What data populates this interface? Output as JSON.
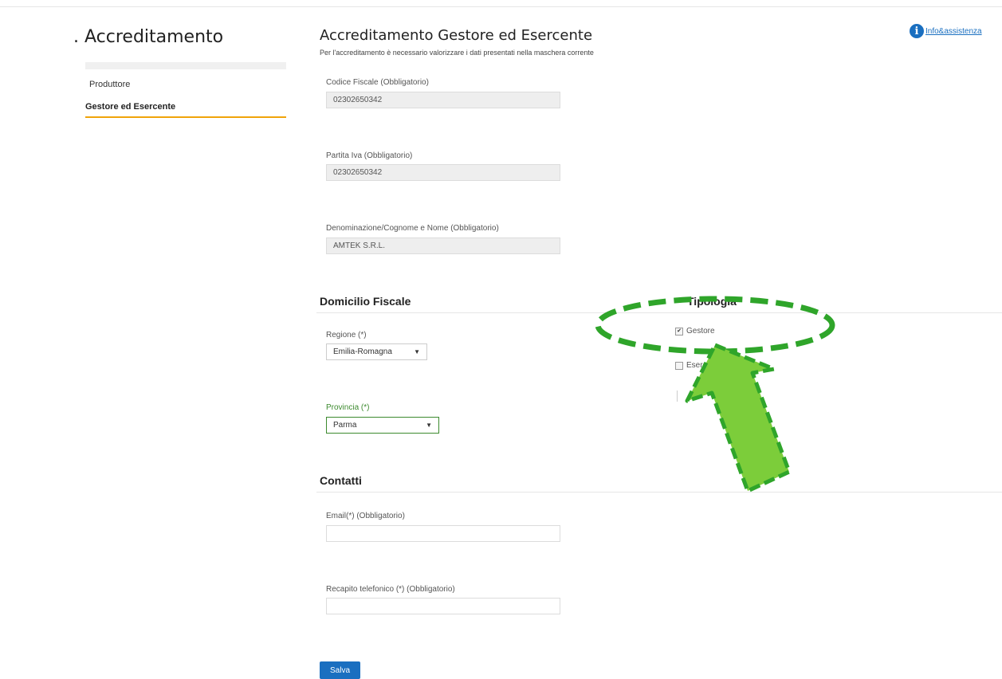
{
  "sidebar": {
    "title": ". Accreditamento",
    "items": [
      {
        "label": "Produttore"
      },
      {
        "label": "Gestore ed Esercente"
      }
    ]
  },
  "header": {
    "title": "Accreditamento Gestore ed Esercente",
    "subtitle": "Per l'accreditamento è necessario valorizzare i dati presentati nella maschera corrente",
    "info_link": "Info&assistenza"
  },
  "form": {
    "codice_fiscale": {
      "label": "Codice Fiscale (Obbligatorio)",
      "value": "02302650342"
    },
    "partita_iva": {
      "label": "Partita Iva (Obbligatorio)",
      "value": "02302650342"
    },
    "denominazione": {
      "label": "Denominazione/Cognome e Nome (Obbligatorio)",
      "value": "AMTEK S.R.L."
    },
    "domicilio": {
      "title": "Domicilio Fiscale",
      "regione": {
        "label": "Regione (*)",
        "value": "Emilia-Romagna"
      },
      "provincia": {
        "label": "Provincia (*)",
        "value": "Parma"
      }
    },
    "tipologia": {
      "title": "Tipologia",
      "options": [
        {
          "label": "Gestore",
          "checked": true
        },
        {
          "label": "Esercente",
          "checked": false
        }
      ]
    },
    "contatti": {
      "title": "Contatti",
      "email": {
        "label": "Email(*) (Obbligatorio)",
        "value": ""
      },
      "telefono": {
        "label": "Recapito telefonico (*) (Obbligatorio)",
        "value": ""
      }
    },
    "save_label": "Salva"
  },
  "icons": {
    "info": "info-icon",
    "caret": "chevron-down-icon",
    "arrow": "annotation-arrow-icon"
  },
  "colors": {
    "accent": "#1a6fc0",
    "active_underline": "#f0a30a",
    "annotation": "#2fa52a",
    "annotation_fill": "#7ccd3a"
  }
}
